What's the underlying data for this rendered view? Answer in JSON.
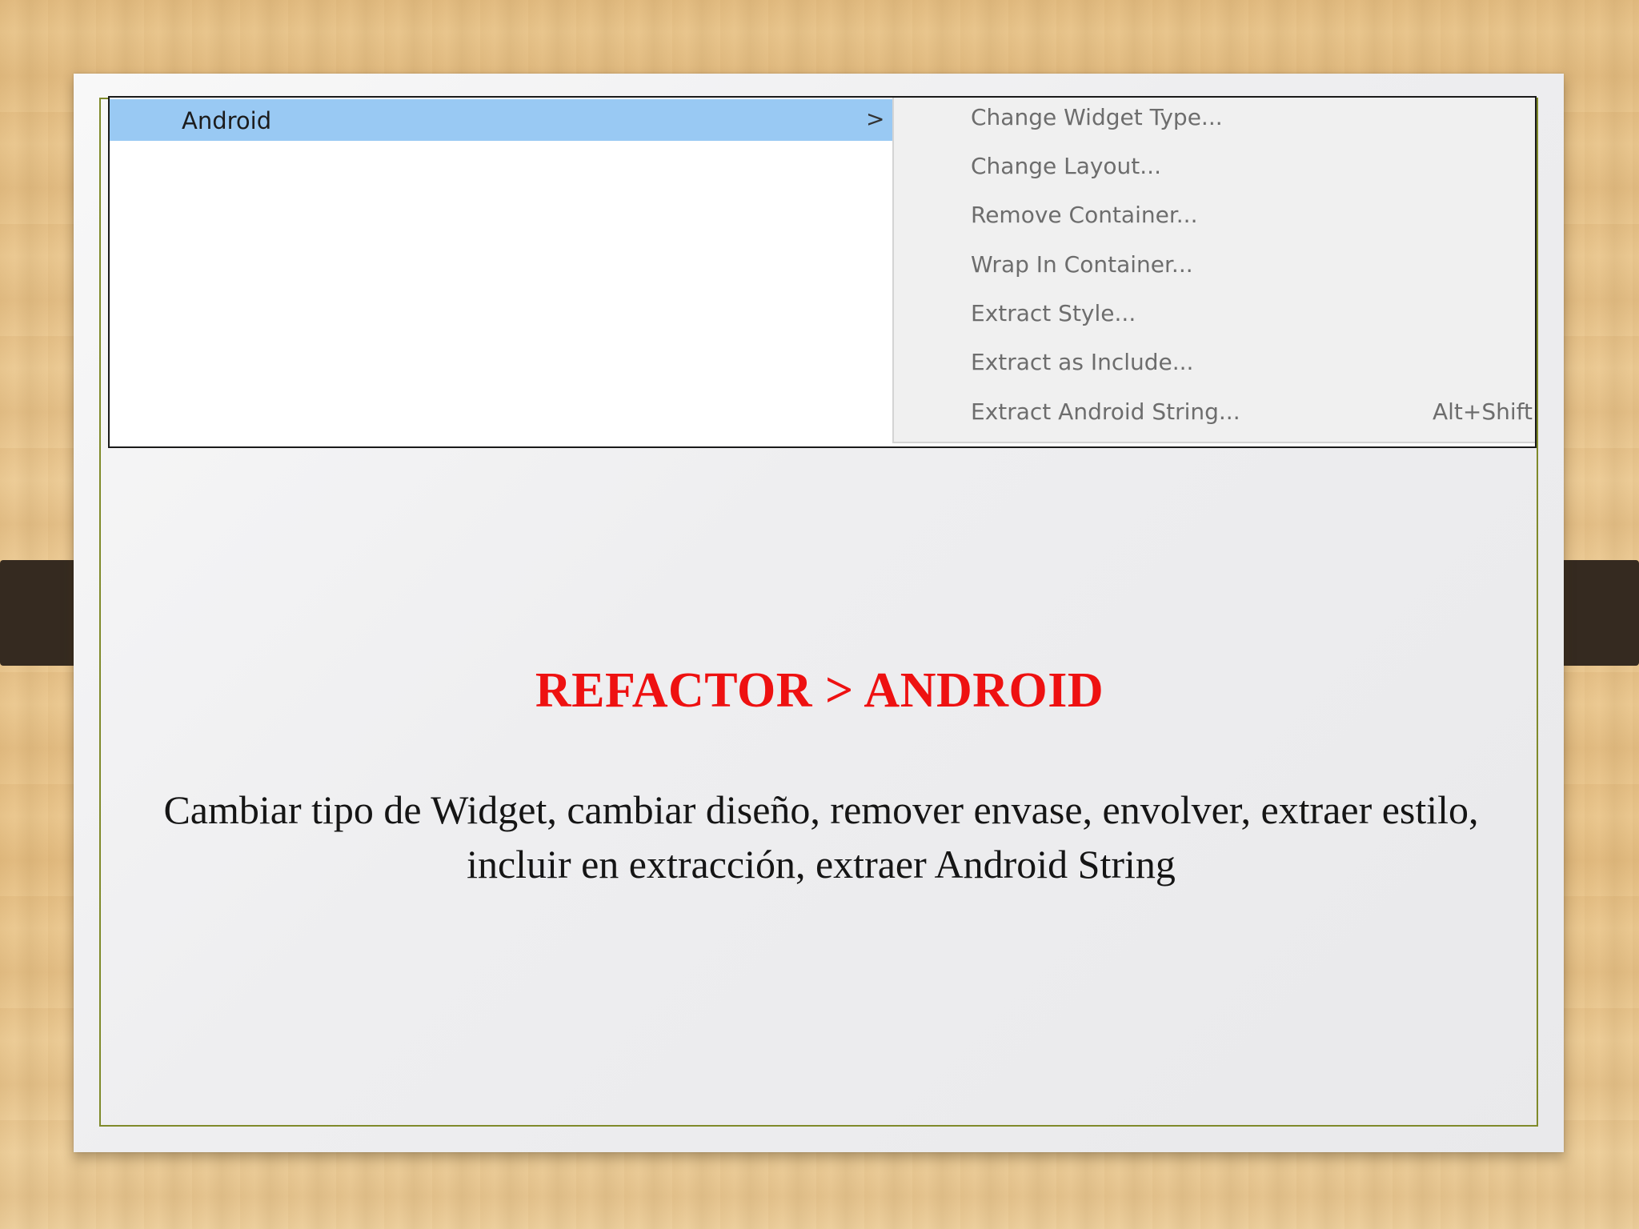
{
  "context_menu": {
    "parent_item": {
      "label": "Android",
      "chevron": ">"
    },
    "submenu_items": [
      {
        "label": "Change Widget Type...",
        "shortcut": ""
      },
      {
        "label": "Change Layout...",
        "shortcut": ""
      },
      {
        "label": "Remove Container...",
        "shortcut": ""
      },
      {
        "label": "Wrap In Container...",
        "shortcut": ""
      },
      {
        "label": "Extract Style...",
        "shortcut": ""
      },
      {
        "label": "Extract as Include...",
        "shortcut": ""
      },
      {
        "label": "Extract Android String...",
        "shortcut": "Alt+Shift+A, S"
      }
    ],
    "colors": {
      "highlight": "#99c9f3",
      "submenu_background": "#f0f0f0",
      "disabled_text": "#6d6d6d"
    }
  },
  "slide": {
    "title": "REFACTOR > ANDROID",
    "body": "Cambiar tipo de Widget, cambiar diseño, remover envase, envolver, extraer estilo, incluir en extracción, extraer Android String",
    "colors": {
      "title": "#ee1111",
      "body": "#151515",
      "frame": "#7f8a2a"
    }
  }
}
